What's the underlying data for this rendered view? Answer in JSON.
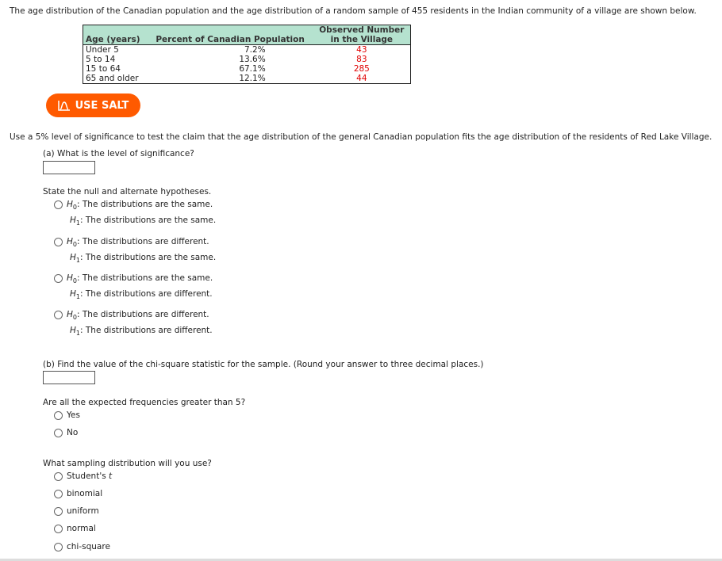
{
  "intro": "The age distribution of the Canadian population and the age distribution of a random sample of 455 residents in the Indian community of a village are shown below.",
  "table": {
    "headers": [
      "Age (years)",
      "Percent of Canadian Population",
      "Observed Number",
      "in the Village"
    ],
    "rows": [
      {
        "age": "Under 5",
        "percent": "7.2%",
        "observed": "43"
      },
      {
        "age": "5 to 14",
        "percent": "13.6%",
        "observed": "83"
      },
      {
        "age": "15 to 64",
        "percent": "67.1%",
        "observed": "285"
      },
      {
        "age": "65 and older",
        "percent": "12.1%",
        "observed": "44"
      }
    ],
    "header_color": "#b5e2cf",
    "observed_color": "#e00000"
  },
  "salt_button": {
    "label": "USE SALT",
    "icon": "bell-curve-icon",
    "color": "#ff5a00"
  },
  "claim": "Use a 5% level of significance to test the claim that the age distribution of the general Canadian population fits the age distribution of the residents of Red Lake Village.",
  "part_a": {
    "question": "(a) What is the level of significance?",
    "value": ""
  },
  "hypotheses": {
    "prompt": "State the null and alternate hypotheses.",
    "options": [
      {
        "h0": ": The distributions are the same.",
        "h1": ": The distributions are the same."
      },
      {
        "h0": ": The distributions are different.",
        "h1": ": The distributions are the same."
      },
      {
        "h0": ": The distributions are the same.",
        "h1": ": The distributions are different."
      },
      {
        "h0": ": The distributions are different.",
        "h1": ": The distributions are different."
      }
    ]
  },
  "part_b": {
    "question": "(b) Find the value of the chi-square statistic for the sample. (Round your answer to three decimal places.)",
    "value": ""
  },
  "expected": {
    "prompt": "Are all the expected frequencies greater than 5?",
    "options": [
      "Yes",
      "No"
    ]
  },
  "sampling": {
    "prompt": "What sampling distribution will you use?",
    "options": [
      "Student's ",
      "binomial",
      "uniform",
      "normal",
      "chi-square"
    ],
    "t": "t"
  }
}
